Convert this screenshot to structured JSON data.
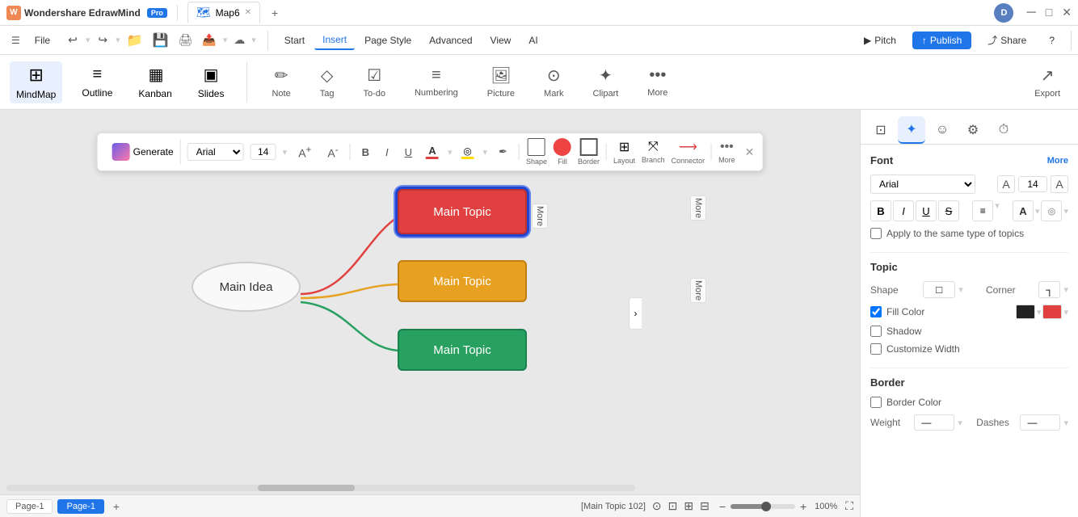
{
  "app": {
    "name": "Wondershare EdrawMind",
    "plan": "Pro",
    "tab_name": "Map6",
    "user_initial": "D"
  },
  "titlebar": {
    "window_controls": [
      "minimize",
      "maximize",
      "close"
    ]
  },
  "menubar": {
    "items": [
      "File",
      "Start",
      "Insert",
      "Page Style",
      "Advanced",
      "View",
      "AI"
    ],
    "active": "Insert",
    "right_items": [
      "Pitch",
      "Publish",
      "Share"
    ]
  },
  "toolbar": {
    "items": [
      {
        "label": "MindMap",
        "icon": "⊞"
      },
      {
        "label": "Outline",
        "icon": "≡"
      },
      {
        "label": "Kanban",
        "icon": "▦"
      },
      {
        "label": "Slides",
        "icon": "▣"
      }
    ],
    "insert_items": [
      {
        "label": "Note",
        "icon": "✏️"
      },
      {
        "label": "Tag",
        "icon": "◇"
      },
      {
        "label": "To-do",
        "icon": "☑"
      },
      {
        "label": "Numbering",
        "icon": "≡"
      },
      {
        "label": "Picture",
        "icon": "🖼"
      },
      {
        "label": "Mark",
        "icon": "⊙"
      },
      {
        "label": "Clipart",
        "icon": "✦"
      },
      {
        "label": "More",
        "icon": "•••"
      }
    ],
    "right_item": {
      "label": "Export",
      "icon": "↗"
    }
  },
  "floating_toolbar": {
    "generate_label": "Generate",
    "font_name": "Arial",
    "font_size": "14",
    "buttons": [
      "B",
      "I",
      "U",
      "A",
      "◎",
      "✒"
    ],
    "shape_label": "Shape",
    "fill_label": "Fill",
    "border_label": "Border",
    "layout_label": "Layout",
    "branch_label": "Branch",
    "connector_label": "Connector",
    "more_label": "More"
  },
  "mindmap": {
    "main_idea": "Main Idea",
    "topics": [
      {
        "label": "Main Topic",
        "color": "#e04040",
        "position": "top"
      },
      {
        "label": "Main Topic",
        "color": "#e8a020",
        "position": "middle"
      },
      {
        "label": "Main Topic",
        "color": "#28a060",
        "position": "bottom"
      }
    ]
  },
  "right_panel": {
    "tabs": [
      {
        "icon": "⊡",
        "name": "format"
      },
      {
        "icon": "✦",
        "name": "ai"
      },
      {
        "icon": "☺",
        "name": "emoji"
      },
      {
        "icon": "⚙",
        "name": "settings"
      },
      {
        "icon": "⏱",
        "name": "timer"
      }
    ],
    "active_tab": "ai",
    "font_section": {
      "title": "Font",
      "more_label": "More",
      "font_name": "Arial",
      "font_size": "14",
      "bold": false,
      "italic": false,
      "underline": false,
      "strikethrough": false,
      "align": "left",
      "font_color": "#000000",
      "highlight_color": "#ffffff",
      "apply_same_checkbox": false,
      "apply_same_label": "Apply to the same type of topics"
    },
    "topic_section": {
      "title": "Topic",
      "shape_label": "Shape",
      "shape_value": "□",
      "corner_label": "Corner",
      "corner_value": "┐",
      "fill_color_checked": true,
      "fill_color_label": "Fill Color",
      "border_color": "#222222",
      "fill_color": "#e04040",
      "shadow_checked": false,
      "shadow_label": "Shadow",
      "customize_width_checked": false,
      "customize_width_label": "Customize Width"
    },
    "border_section": {
      "title": "Border",
      "border_color_checked": false,
      "border_color_label": "Border Color",
      "weight_label": "Weight",
      "weight_value": "—",
      "dashes_label": "Dashes",
      "dashes_value": "—"
    }
  },
  "statusbar": {
    "page_label": "Page-1",
    "current_page": "Page-1",
    "status_text": "[Main Topic 102]",
    "zoom_level": "100%"
  }
}
